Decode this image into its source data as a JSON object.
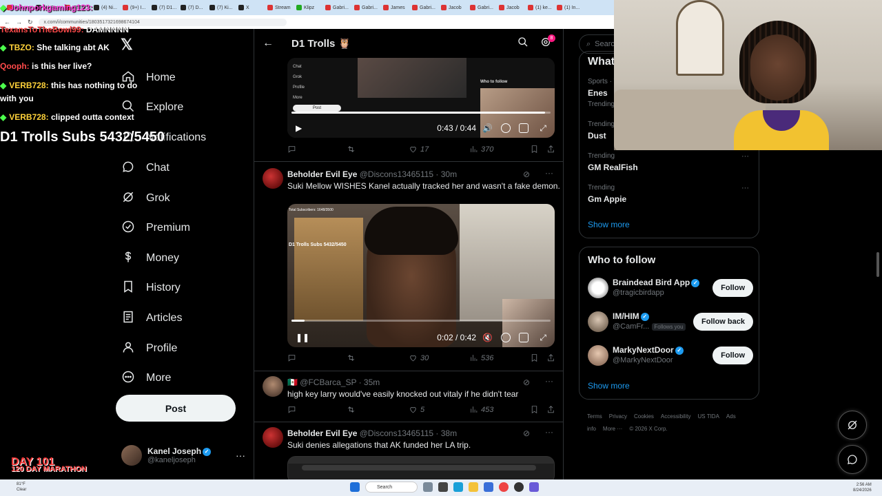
{
  "browser": {
    "tabs": [
      {
        "label": "Stream",
        "color": "red"
      },
      {
        "label": "(1) Str...",
        "color": "dark"
      },
      {
        "label": "IRLTol...",
        "color": "red"
      },
      {
        "label": "(4) Ni...",
        "color": "dark"
      },
      {
        "label": "(9+) I...",
        "color": "red"
      },
      {
        "label": "(7) D1...",
        "color": "dark"
      },
      {
        "label": "(7) D...",
        "color": "dark"
      },
      {
        "label": "(7) Ki...",
        "color": "dark"
      },
      {
        "label": "X",
        "color": "dark"
      },
      {
        "label": "Stream",
        "color": "red"
      },
      {
        "label": "Klipz",
        "color": "green"
      },
      {
        "label": "Gabri...",
        "color": "red"
      },
      {
        "label": "Gabri...",
        "color": "red"
      },
      {
        "label": "James",
        "color": "red"
      },
      {
        "label": "Gabri...",
        "color": "red"
      },
      {
        "label": "Jacob",
        "color": "red"
      },
      {
        "label": "Gabri...",
        "color": "red"
      },
      {
        "label": "Jacob",
        "color": "red"
      },
      {
        "label": "(1) ke...",
        "color": "red"
      },
      {
        "label": "(1) In...",
        "color": "red"
      }
    ],
    "url": "x.com/i/communities/1803517321698674104"
  },
  "stream_chat": [
    {
      "user": "Johnporkgaming123:",
      "message": "",
      "style": "u3",
      "diamond": true
    },
    {
      "user": "TexansToTheBowl99:",
      "message": "DAMNNNN",
      "style": "u1",
      "diamond": false
    },
    {
      "user": "TBZO:",
      "message": "She talking abt AK",
      "style": "u2",
      "diamond": true
    },
    {
      "user": "Qooph:",
      "message": "is this her live?",
      "style": "u1",
      "diamond": false
    },
    {
      "user": "VERB728:",
      "message": "this has nothing to do",
      "style": "u2",
      "diamond": true
    },
    {
      "user": "",
      "message": "with you",
      "style": "u2",
      "diamond": false
    },
    {
      "user": "VERB728:",
      "message": "clipped outta context",
      "style": "u2",
      "diamond": true
    }
  ],
  "stream_subs": "D1 Trolls Subs 5432/5450",
  "marathon": {
    "day": "DAY 101",
    "label": "120 DAY MARATHON"
  },
  "nav": {
    "logo": "𝕏",
    "items": [
      {
        "label": "Home",
        "icon": "home-icon"
      },
      {
        "label": "Explore",
        "icon": "search-icon"
      },
      {
        "label": "Notifications",
        "icon": "bell-icon"
      },
      {
        "label": "Chat",
        "icon": "chat-icon"
      },
      {
        "label": "Grok",
        "icon": "grok-icon"
      },
      {
        "label": "Premium",
        "icon": "premium-icon"
      },
      {
        "label": "Money",
        "icon": "money-icon"
      },
      {
        "label": "History",
        "icon": "bookmark-icon"
      },
      {
        "label": "Articles",
        "icon": "article-icon"
      },
      {
        "label": "Profile",
        "icon": "person-icon"
      },
      {
        "label": "More",
        "icon": "more-icon"
      }
    ],
    "post_label": "Post",
    "account": {
      "name": "Kanel Joseph",
      "handle": "@kaneljoseph"
    }
  },
  "community": {
    "title": "D1 Trolls 🦉",
    "notif_count": "8"
  },
  "video1": {
    "time": "0:43 / 0:44",
    "progress": 0.98,
    "inner_menu": [
      "Chat",
      "Grok",
      "Profile",
      "More"
    ],
    "inner_post": "Post",
    "who_to_follow": "Who to follow",
    "stats": {
      "comments": "",
      "reposts": "",
      "likes": "17",
      "views": "370"
    }
  },
  "tweets": [
    {
      "name": "Beholder Evil Eye",
      "handle": "@Discons13465115 · 30m",
      "text": "Suki Mellow WISHES Kanel actually tracked her and wasn't a fake demon.",
      "video_time": "0:02 / 0:42",
      "video_progress": 0.05,
      "overlay_text": "Total Subscribers: 1648/3500",
      "overlay_subs": "D1 Trolls Subs 5432/5450",
      "stats": {
        "comments": "",
        "reposts": "",
        "likes": "30",
        "views": "536"
      }
    },
    {
      "name": "",
      "handle": "🇲🇽 @FCBarca_SP · 35m",
      "text": "high key larry would've easily knocked out vitaly if he didn't tear",
      "stats": {
        "comments": "",
        "reposts": "",
        "likes": "5",
        "views": "453"
      }
    },
    {
      "name": "Beholder Evil Eye",
      "handle": "@Discons13465115 · 38m",
      "text": "Suki denies allegations that AK funded her LA trip.",
      "stats": {}
    }
  ],
  "right": {
    "search_placeholder": "Search",
    "trends_title": "What's happening",
    "trends": [
      {
        "category": "Sports · Trending",
        "title": "Enes",
        "sub": "Trending"
      },
      {
        "category": "Trending",
        "title": "Dust",
        "sub": ""
      },
      {
        "category": "Trending",
        "title": "GM RealFish",
        "sub": ""
      },
      {
        "category": "Trending",
        "title": "Gm Appie",
        "sub": ""
      }
    ],
    "show_more": "Show more",
    "follow_title": "Who to follow",
    "follow": [
      {
        "name": "Braindead Bird App",
        "handle": "@tragicbirdapp",
        "button": "Follow",
        "follows_you": "",
        "avatar": "bird"
      },
      {
        "name": "IM/HIM",
        "handle": "@CamFr...",
        "button": "Follow back",
        "follows_you": "Follows you",
        "avatar": "imh"
      },
      {
        "name": "MarkyNextDoor",
        "handle": "@MarkyNextDoor",
        "button": "Follow",
        "follows_you": "",
        "avatar": "mnd"
      }
    ],
    "footer": [
      "Terms",
      "Privacy",
      "Cookies",
      "Accessibility",
      "US TIDA",
      "Ads info",
      "More ···",
      "© 2026 X Corp."
    ]
  },
  "taskbar": {
    "weather_temp": "81°F",
    "weather_desc": "Clear",
    "search_label": "Search",
    "time": "2:56 AM",
    "date": "8/24/2026"
  },
  "colors": {
    "accent": "#1d9bf0",
    "background": "#000000",
    "border": "#2f3336",
    "muted": "#71767b",
    "badge": "#f91880"
  }
}
